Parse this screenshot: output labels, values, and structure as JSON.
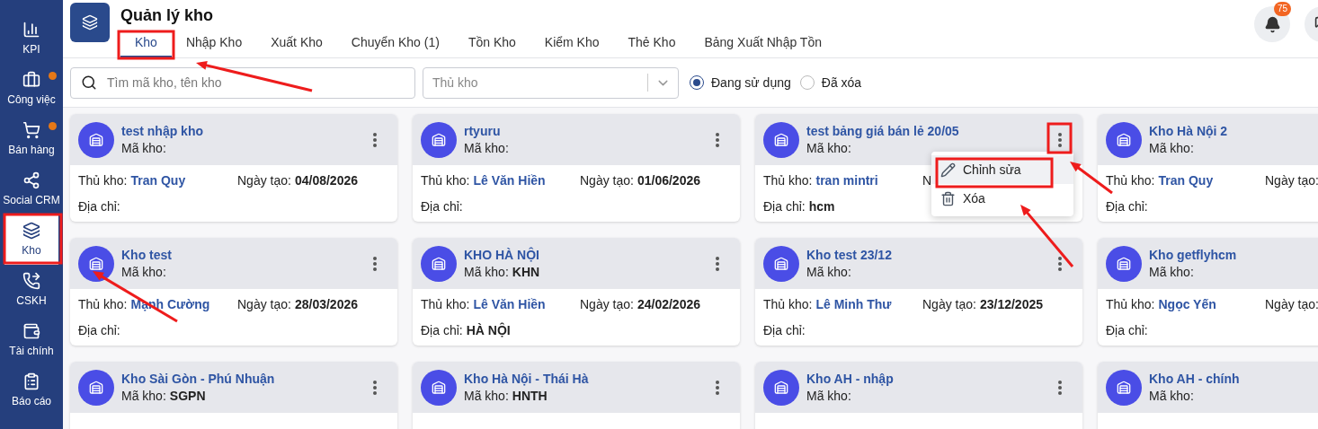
{
  "sidebar": {
    "items": [
      {
        "label": "KPI",
        "selected": false,
        "notification_dot": false
      },
      {
        "label": "Công việc",
        "selected": false,
        "notification_dot": true
      },
      {
        "label": "Bán hàng",
        "selected": false,
        "notification_dot": true
      },
      {
        "label": "Social CRM",
        "selected": false,
        "notification_dot": false
      },
      {
        "label": "Kho",
        "selected": true,
        "notification_dot": false
      },
      {
        "label": "CSKH",
        "selected": false,
        "notification_dot": false
      },
      {
        "label": "Tài chính",
        "selected": false,
        "notification_dot": false
      },
      {
        "label": "Báo cáo",
        "selected": false,
        "notification_dot": false
      }
    ]
  },
  "header": {
    "title": "Quản lý kho",
    "tabs": [
      {
        "label": "Kho",
        "selected": true
      },
      {
        "label": "Nhập Kho",
        "selected": false
      },
      {
        "label": "Xuất Kho",
        "selected": false
      },
      {
        "label": "Chuyển Kho (1)",
        "selected": false
      },
      {
        "label": "Tồn Kho",
        "selected": false
      },
      {
        "label": "Kiểm Kho",
        "selected": false
      },
      {
        "label": "Thẻ Kho",
        "selected": false
      },
      {
        "label": "Bảng Xuất Nhập Tồn",
        "selected": false
      }
    ],
    "notification_count": "75"
  },
  "filters": {
    "search": {
      "placeholder": "Tìm mã kho, tên kho"
    },
    "keeper_select": {
      "placeholder": "Thủ kho"
    },
    "status": [
      {
        "label": "Đang sử dụng",
        "selected": true
      },
      {
        "label": "Đã xóa",
        "selected": false
      }
    ]
  },
  "warehouses": [
    {
      "name": "test nhập kho",
      "code_label": "Mã kho:",
      "keeper_label": "Thủ kho:",
      "keeper": "Tran Quy",
      "date_label": "Ngày tạo:",
      "date": "04/08/2026",
      "address_label": "Địa chỉ:",
      "menu_open": false
    },
    {
      "name": "rtyuru",
      "code_label": "Mã kho:",
      "keeper_label": "Thủ kho:",
      "keeper": "Lê Văn Hiền",
      "date_label": "Ngày tạo:",
      "date": "01/06/2026",
      "address_label": "Địa chỉ:",
      "menu_open": false
    },
    {
      "name": "test bảng giá bán lẻ 20/05",
      "code_label": "Mã kho:",
      "keeper_label": "Thủ kho:",
      "keeper": "tran mintri",
      "date_label": "N",
      "address_label": "Địa chỉ:",
      "address": "hcm",
      "menu_open": true
    },
    {
      "name": "Kho Hà Nội 2",
      "code_label": "Mã kho:",
      "keeper_label": "Thủ kho:",
      "keeper": "Tran Quy",
      "date_label": "Ngày tạo:",
      "address_label": "Địa chỉ:",
      "menu_open": false
    },
    {
      "name": "Kho test",
      "code_label": "Mã kho:",
      "keeper_label": "Thủ kho:",
      "keeper": "Mạnh Cường",
      "date_label": "Ngày tạo:",
      "date": "28/03/2026",
      "address_label": "Địa chỉ:",
      "menu_open": false
    },
    {
      "name": "KHO HÀ NỘI",
      "code_label": "Mã kho:",
      "code": "KHN",
      "keeper_label": "Thủ kho:",
      "keeper": "Lê Văn Hiền",
      "date_label": "Ngày tạo:",
      "date": "24/02/2026",
      "address_label": "Địa chỉ:",
      "address": "HÀ NỘI",
      "menu_open": false
    },
    {
      "name": "Kho test 23/12",
      "code_label": "Mã kho:",
      "keeper_label": "Thủ kho:",
      "keeper": "Lê Minh Thư",
      "date_label": "Ngày tạo:",
      "date": "23/12/2025",
      "address_label": "Địa chỉ:",
      "menu_open": false
    },
    {
      "name": "Kho getflyhcm",
      "code_label": "Mã kho:",
      "keeper_label": "Thủ kho:",
      "keeper": "Ngọc Yến",
      "date_label": "Ngày tạo:",
      "address_label": "Địa chỉ:",
      "menu_open": false
    },
    {
      "name": "Kho Sài Gòn - Phú Nhuận",
      "code_label": "Mã kho:",
      "code": "SGPN",
      "menu_open": false
    },
    {
      "name": "Kho Hà Nội - Thái Hà",
      "code_label": "Mã kho:",
      "code": "HNTH",
      "menu_open": false
    },
    {
      "name": "Kho AH - nhập",
      "code_label": "Mã kho:",
      "menu_open": false
    },
    {
      "name": "Kho AH - chính",
      "code_label": "Mã kho:",
      "menu_open": false
    }
  ],
  "card_menu": {
    "items": [
      {
        "label": "Chỉnh sửa",
        "kind": "edit",
        "highlighted": true
      },
      {
        "label": "Xóa",
        "kind": "delete",
        "highlighted": false
      }
    ]
  }
}
